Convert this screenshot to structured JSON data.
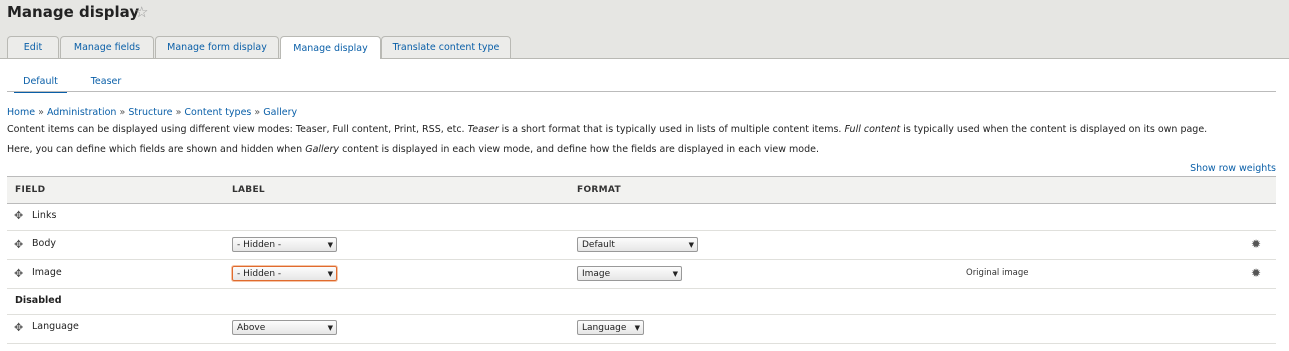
{
  "page": {
    "title": "Manage display",
    "favorite_icon": "star-icon"
  },
  "tabs": [
    {
      "label": "Edit",
      "active": false
    },
    {
      "label": "Manage fields",
      "active": false
    },
    {
      "label": "Manage form display",
      "active": false
    },
    {
      "label": "Manage display",
      "active": true
    },
    {
      "label": "Translate content type",
      "active": false
    }
  ],
  "subtabs": [
    {
      "label": "Default",
      "active": true
    },
    {
      "label": "Teaser",
      "active": false
    }
  ],
  "breadcrumb": {
    "items": [
      "Home",
      "Administration",
      "Structure",
      "Content types",
      "Gallery"
    ],
    "separator": "»"
  },
  "description": {
    "line1_a": "Content items can be displayed using different view modes: Teaser, Full content, Print, RSS, etc.",
    "line1_teaser": "Teaser",
    "line1_b": "is a short format that is typically used in lists of multiple content items.",
    "line1_full": "Full content",
    "line1_c": "is typically used when the content is displayed on its own page.",
    "line2_a": "Here, you can define which fields are shown and hidden when",
    "line2_gallery": "Gallery",
    "line2_b": "content is displayed in each view mode, and define how the fields are displayed in each view mode."
  },
  "row_weights_link": "Show row weights",
  "table": {
    "headers": {
      "field": "FIELD",
      "label": "LABEL",
      "format": "FORMAT"
    },
    "rows": [
      {
        "field": "Links",
        "label": null,
        "format": null,
        "summary": null
      },
      {
        "field": "Body",
        "label": "- Hidden -",
        "format": "Default",
        "summary": null
      },
      {
        "field": "Image",
        "label": "- Hidden -",
        "format": "Image",
        "summary": "Original image"
      }
    ],
    "disabled_region": {
      "title": "Disabled"
    },
    "disabled_rows": [
      {
        "field": "Language",
        "label": "Above",
        "format": "Language"
      }
    ]
  },
  "colors": {
    "link": "#0a5fa8",
    "header_band": "#e6e6e3",
    "focus": "#e06a2e"
  }
}
